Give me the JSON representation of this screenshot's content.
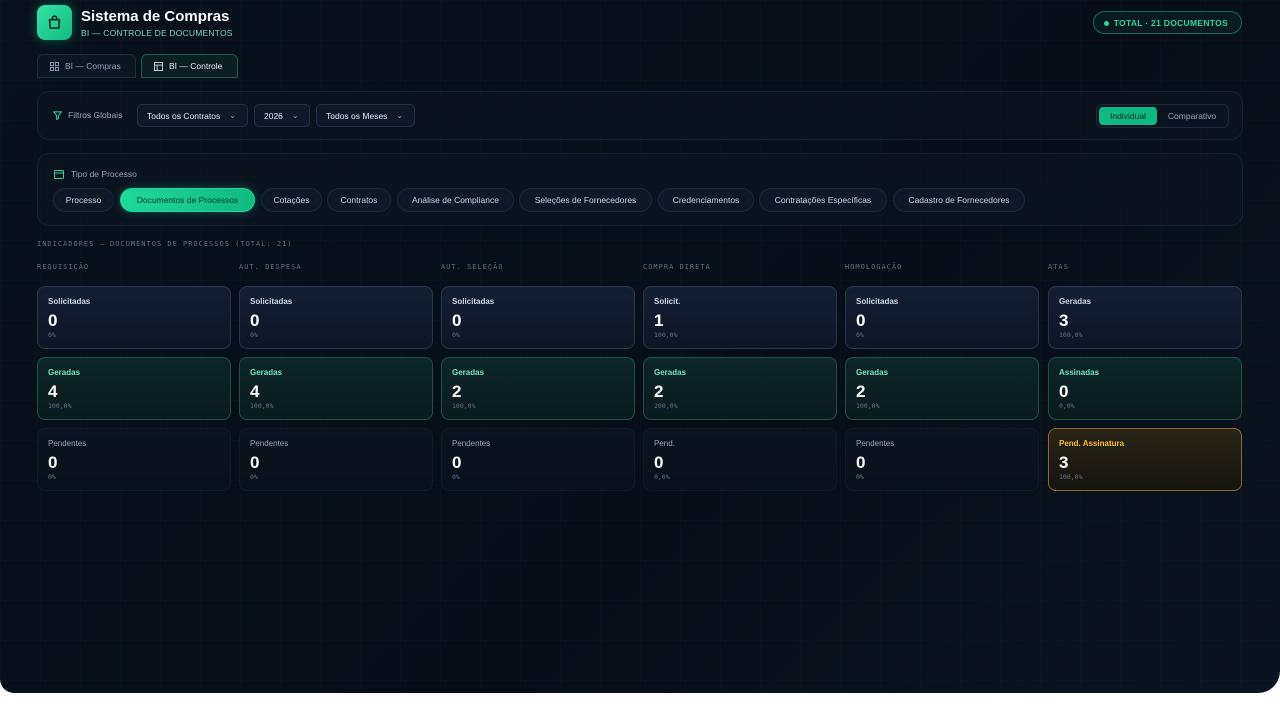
{
  "header": {
    "title": "Sistema de Compras",
    "subtitle": "BI — CONTROLE DE DOCUMENTOS",
    "total_badge": "TOTAL · 21 DOCUMENTOS"
  },
  "top_tabs": [
    {
      "label": "BI — Compras",
      "icon": "grid-icon",
      "active": false
    },
    {
      "label": "BI — Controle",
      "icon": "table-icon",
      "active": true
    }
  ],
  "filters": {
    "label": "Filtros Globais",
    "contract": "Todos os Contratos",
    "year": "2026",
    "month": "Todos os Meses",
    "view_modes": [
      "Individual",
      "Comparativo"
    ],
    "active_view": "Individual"
  },
  "tipo_processo": {
    "title": "Tipo de Processo",
    "pills": [
      "Processo",
      "Documentos de Processos",
      "Cotações",
      "Contratos",
      "Análise de Compliance",
      "Seleções de Fornecedores",
      "Credenciamentos",
      "Contratações Específicas",
      "Cadastro de Fornecedores"
    ],
    "active": "Documentos de Processos"
  },
  "indicators": {
    "section_label": "INDICADORES — DOCUMENTOS DE PROCESSOS (TOTAL: 21)",
    "columns": [
      {
        "label": "REQUISIÇÃO",
        "cards": [
          {
            "label": "Solicitadas",
            "value": "0",
            "pct": "0%"
          },
          {
            "label": "Geradas",
            "value": "4",
            "pct": "100,0%"
          },
          {
            "label": "Pendentes",
            "value": "0",
            "pct": "0%"
          }
        ]
      },
      {
        "label": "AUT. DESPESA",
        "cards": [
          {
            "label": "Solicitadas",
            "value": "0",
            "pct": "0%"
          },
          {
            "label": "Geradas",
            "value": "4",
            "pct": "100,0%"
          },
          {
            "label": "Pendentes",
            "value": "0",
            "pct": "0%"
          }
        ]
      },
      {
        "label": "AUT. SELEÇÃO",
        "cards": [
          {
            "label": "Solicitadas",
            "value": "0",
            "pct": "0%"
          },
          {
            "label": "Geradas",
            "value": "2",
            "pct": "100,0%"
          },
          {
            "label": "Pendentes",
            "value": "0",
            "pct": "0%"
          }
        ]
      },
      {
        "label": "COMPRA DIRETA",
        "cards": [
          {
            "label": "Solicit.",
            "value": "1",
            "pct": "100,0%"
          },
          {
            "label": "Geradas",
            "value": "2",
            "pct": "200,0%"
          },
          {
            "label": "Pend.",
            "value": "0",
            "pct": "0,0%"
          }
        ]
      },
      {
        "label": "HOMOLOGAÇÃO",
        "cards": [
          {
            "label": "Solicitadas",
            "value": "0",
            "pct": "0%"
          },
          {
            "label": "Geradas",
            "value": "2",
            "pct": "100,0%"
          },
          {
            "label": "Pendentes",
            "value": "0",
            "pct": "0%"
          }
        ]
      },
      {
        "label": "ATAS",
        "cards": [
          {
            "label": "Geradas",
            "value": "3",
            "pct": "100,0%"
          },
          {
            "label": "Assinadas",
            "value": "0",
            "pct": "0,0%"
          },
          {
            "label": "Pend. Assinatura",
            "value": "3",
            "pct": "100,0%"
          }
        ]
      }
    ]
  },
  "colors": {
    "accent": "#10b981",
    "background": "#07101b",
    "warning": "#fbbf24"
  }
}
